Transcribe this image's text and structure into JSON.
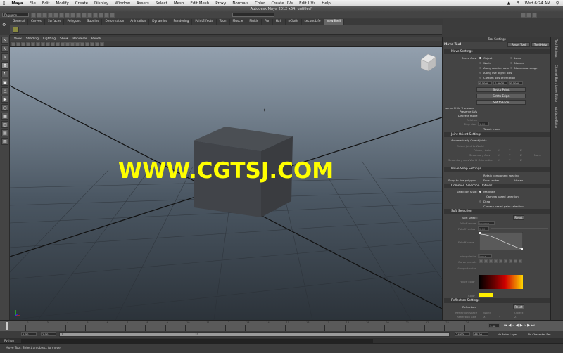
{
  "menubar": {
    "app": "Maya",
    "items": [
      "File",
      "Edit",
      "Modify",
      "Create",
      "Display",
      "Window",
      "Assets",
      "Select",
      "Mesh",
      "Edit Mesh",
      "Proxy",
      "Normals",
      "Color",
      "Create UVs",
      "Edit UVs",
      "Help"
    ],
    "clock": "Wed 6:24 AM"
  },
  "window": {
    "title": "Autodesk Maya 2012 x64: untitled*"
  },
  "statusline": {
    "menuset": "Polygons"
  },
  "shelf": {
    "tabs": [
      "General",
      "Curves",
      "Surfaces",
      "Polygons",
      "Subdivs",
      "Deformation",
      "Animation",
      "Dynamics",
      "Rendering",
      "PaintEffects",
      "Toon",
      "Muscle",
      "Fluids",
      "Fur",
      "Hair",
      "nCloth",
      "secondLife",
      "newShelf"
    ],
    "active_tab": "newShelf"
  },
  "panel": {
    "menus": [
      "View",
      "Shading",
      "Lighting",
      "Show",
      "Renderer",
      "Panels"
    ]
  },
  "viewport": {
    "watermark": "WWW.CGTSJ.COM"
  },
  "tool_settings": {
    "header": "Tool Settings",
    "tool_name": "Move Tool",
    "reset_tool": "Reset Tool",
    "tool_help": "Tool Help",
    "move_settings": "Move Settings",
    "move_axis_label": "Move Axis:",
    "axis_options": [
      "Object",
      "Local",
      "World",
      "Normal",
      "Along rotation axis",
      "Normals average",
      "Along live object axis",
      "Custom axis orientation"
    ],
    "custom_values": [
      "0.0000",
      "0.0000",
      "0.0000"
    ],
    "set_to_point": "Set to Point",
    "set_to_edge": "Set to Edge",
    "set_to_face": "Set to Face",
    "preserve_child": "serve Child Transform",
    "preserve_uvs": "Preserve UVs",
    "discrete_move": "Discrete move",
    "relative": "Relative",
    "step_size": "Step size",
    "step_value": "1.00",
    "tweak_mode": "Tweak mode",
    "joint_orient": "Joint Orient Settings",
    "auto_orient": "Automatically Orient Joints",
    "orient_world": "Orient Joint to World",
    "primary_axis": "Primary Axis",
    "secondary_axis": "Secondary Axis",
    "secondary_world": "Secondary Axis World Orientation",
    "axes": [
      "X",
      "Y",
      "Z"
    ],
    "none": "None",
    "move_snap": "Move Snap Settings",
    "retain_spacing": "Retain component spacing",
    "snap_live": "Snap to live polygon:",
    "face_center": "Face center",
    "vertex": "Vertex",
    "common_sel": "Common Selection Options",
    "selection_style": "Selection Style:",
    "marquee": "Marquee",
    "camera_based": "Camera based selection",
    "drag": "Drag",
    "camera_paint": "Camera based paint selection",
    "soft_selection": "Soft Selection",
    "soft_select": "Soft Select:",
    "reset": "Reset",
    "falloff_mode": "Falloff mode",
    "falloff_mode_value": "Volume",
    "falloff_radius": "Falloff radius",
    "falloff_radius_value": "5.00",
    "falloff_curve": "Falloff curve",
    "interpolation": "Interpolation",
    "interpolation_value": "None",
    "curve_presets": "Curve presets",
    "viewport_color": "Viewport color",
    "falloff_color": "Falloff color",
    "color": "Color",
    "reflection_settings": "Reflection Settings",
    "reflection": "Reflection:",
    "reflection_space": "Reflection space",
    "world": "World",
    "object": "Object",
    "reflection_axis": "Reflection axis"
  },
  "side_tabs": [
    "Tool Settings",
    "Channel Box / Layer Editor",
    "Attribute Editor"
  ],
  "timeline": {
    "ticks": [
      "1",
      "2",
      "3",
      "4",
      "5",
      "6",
      "7",
      "8",
      "9",
      "10",
      "11",
      "12",
      "13",
      "14",
      "15",
      "16",
      "17",
      "18",
      "19",
      "20",
      "21",
      "22",
      "23",
      "24"
    ],
    "current_frame": "1.00"
  },
  "range": {
    "start": "1.00",
    "start2": "1.00",
    "mid": "1",
    "mid2": "24",
    "end": "24.00",
    "end2": "48.00",
    "anim_layer": "No Anim Layer",
    "char_set": "No Character Set"
  },
  "cmdline": {
    "label": "Python"
  },
  "helpline": {
    "text": "Move Tool: Select an object to move."
  }
}
